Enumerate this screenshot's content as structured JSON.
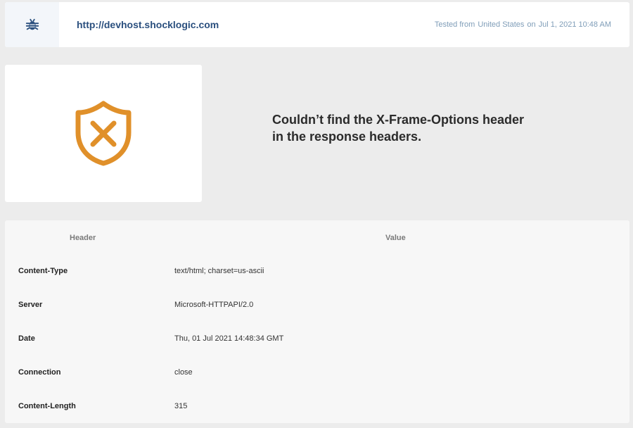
{
  "header": {
    "url": "http://devhost.shocklogic.com",
    "tested_from_label": "Tested from",
    "tested_location": "United States",
    "on_label": "on",
    "tested_time": "Jul 1, 2021 10:48 AM"
  },
  "result": {
    "message_line1": "Couldn’t find the X-Frame-Options header",
    "message_line2": "in the response headers.",
    "status_icon": "shield-x-icon",
    "status_color": "#e0902a"
  },
  "table": {
    "col_header": "Header",
    "col_value": "Value",
    "rows": [
      {
        "header": "Content-Type",
        "value": "text/html; charset=us-ascii"
      },
      {
        "header": "Server",
        "value": "Microsoft-HTTPAPI/2.0"
      },
      {
        "header": "Date",
        "value": "Thu, 01 Jul 2021 14:48:34 GMT"
      },
      {
        "header": "Connection",
        "value": "close"
      },
      {
        "header": "Content-Length",
        "value": "315"
      }
    ]
  },
  "colors": {
    "accent_blue": "#2a4f7e",
    "muted_blue": "#7f9db8",
    "background": "#ececec"
  }
}
